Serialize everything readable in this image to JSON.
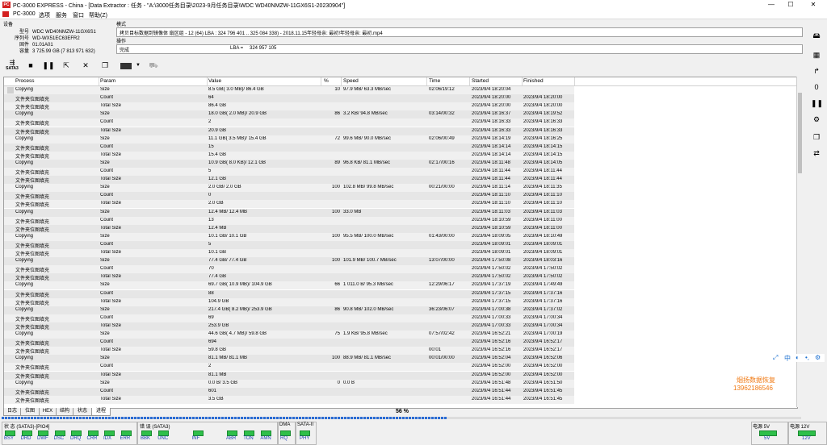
{
  "window": {
    "title": "PC-3000 EXPRESS - China - [Data Extractor : 任务 - \"A:\\3000任务目录\\2023-9月任务目录\\WDC WD40NMZW-11GX6S1-20230904\"]",
    "logo": "PC",
    "minimize": "—",
    "maximize": "☐",
    "close": "✕"
  },
  "menu": [
    "PC-3000",
    "选项",
    "服务",
    "窗口",
    "帮助(Z)"
  ],
  "device": {
    "section_label": "设备",
    "fields": [
      {
        "key": "型号",
        "value": "WDC WD40NMZW-11GX6S1"
      },
      {
        "key": "序列号",
        "value": "WD-WX51EC63EFR2"
      },
      {
        "key": "固件",
        "value": "01.01A01"
      },
      {
        "key": "容量",
        "value": "3 725.99 GB (7 813 971 632)"
      }
    ]
  },
  "mode": {
    "section_label": "模式",
    "value": "拷贝目标数据到镜像体  扇区组 - 12 (64) LBA : 324 796 401 .. 325 084 338) - 2018.11.15年轻母亲: 最初!年轻母亲: 最初.mp4",
    "op_label": "操作",
    "op_value": "完成",
    "lba_label": "LBA =",
    "lba_value": "324 957 105"
  },
  "toolbar": {
    "sata_label": "SATA3",
    "buttons": [
      "stop-icon",
      "pause-icon",
      "export-icon",
      "tools-icon",
      "copy-icon",
      "image-icon",
      "dropdown-icon",
      "disabled-icon"
    ]
  },
  "grid": {
    "columns": [
      "Process",
      "Param",
      "Value",
      "%",
      "Speed",
      "Time",
      "Started",
      "Finished"
    ],
    "rows": [
      [
        "Copying",
        "Size",
        "8.5 GB( 3.0 MB)/ 86.4 GB",
        "10",
        "97.9 MB/ 63.3 MB/sec",
        "02:06/19:12",
        "2023/9/4 18:20:04",
        ""
      ],
      [
        "文件夹位图填充",
        "Count",
        "64",
        "",
        "",
        "",
        "2023/9/4 18:20:00",
        "2023/9/4 18:20:00"
      ],
      [
        "文件夹位图填充",
        "Total Size",
        "86.4 GB",
        "",
        "",
        "",
        "2023/9/4 18:20:00",
        "2023/9/4 18:20:00"
      ],
      [
        "Copying",
        "Size",
        "18.0 GB( 2.0 MB)/ 20.9 GB",
        "86",
        "3.2 KB/ 94.8 MB/sec",
        "03:14/00:32",
        "2023/9/4 18:16:37",
        "2023/9/4 18:19:52"
      ],
      [
        "文件夹位图填充",
        "Count",
        "2",
        "",
        "",
        "",
        "2023/9/4 18:16:33",
        "2023/9/4 18:16:33"
      ],
      [
        "文件夹位图填充",
        "Total Size",
        "20.9 GB",
        "",
        "",
        "",
        "2023/9/4 18:16:33",
        "2023/9/4 18:16:33"
      ],
      [
        "Copying",
        "Size",
        "11.1 GB( 3.5 MB)/ 15.4 GB",
        "72",
        "99.6 MB/ 90.0 MB/sec",
        "02:06/00:49",
        "2023/9/4 18:14:19",
        "2023/9/4 18:16:25"
      ],
      [
        "文件夹位图填充",
        "Count",
        "15",
        "",
        "",
        "",
        "2023/9/4 18:14:14",
        "2023/9/4 18:14:15"
      ],
      [
        "文件夹位图填充",
        "Total Size",
        "15.4 GB",
        "",
        "",
        "",
        "2023/9/4 18:14:14",
        "2023/9/4 18:14:15"
      ],
      [
        "Copying",
        "Size",
        "10.9 GB( 8.0 KB)/ 12.1 GB",
        "89",
        "96.8 KB/ 81.1 MB/sec",
        "02:17/00:16",
        "2023/9/4 18:11:48",
        "2023/9/4 18:14:05"
      ],
      [
        "文件夹位图填充",
        "Count",
        "5",
        "",
        "",
        "",
        "2023/9/4 18:11:44",
        "2023/9/4 18:11:44"
      ],
      [
        "文件夹位图填充",
        "Total Size",
        "12.1 GB",
        "",
        "",
        "",
        "2023/9/4 18:11:44",
        "2023/9/4 18:11:44"
      ],
      [
        "Copying",
        "Size",
        "2.0 GB/ 2.0 GB",
        "100",
        "102.8 MB/ 99.8 MB/sec",
        "00:21/00:00",
        "2023/9/4 18:11:14",
        "2023/9/4 18:11:35"
      ],
      [
        "文件夹位图填充",
        "Count",
        "0",
        "",
        "",
        "",
        "2023/9/4 18:11:10",
        "2023/9/4 18:11:10"
      ],
      [
        "文件夹位图填充",
        "Total Size",
        "2.0 GB",
        "",
        "",
        "",
        "2023/9/4 18:11:10",
        "2023/9/4 18:11:10"
      ],
      [
        "Copying",
        "Size",
        "12.4 MB/ 12.4 MB",
        "100",
        "33.0 MB",
        "",
        "2023/9/4 18:11:03",
        "2023/9/4 18:11:03"
      ],
      [
        "文件夹位图填充",
        "Count",
        "13",
        "",
        "",
        "",
        "2023/9/4 18:10:59",
        "2023/9/4 18:11:00"
      ],
      [
        "文件夹位图填充",
        "Total Size",
        "12.4 MB",
        "",
        "",
        "",
        "2023/9/4 18:10:59",
        "2023/9/4 18:11:00"
      ],
      [
        "Copying",
        "Size",
        "10.1 GB/ 10.1 GB",
        "100",
        "95.5 MB/ 100.0 MB/sec",
        "01:43/00:00",
        "2023/9/4 18:09:05",
        "2023/9/4 18:10:49"
      ],
      [
        "文件夹位图填充",
        "Count",
        "5",
        "",
        "",
        "",
        "2023/9/4 18:09:01",
        "2023/9/4 18:09:01"
      ],
      [
        "文件夹位图填充",
        "Total Size",
        "10.1 GB",
        "",
        "",
        "",
        "2023/9/4 18:09:01",
        "2023/9/4 18:09:01"
      ],
      [
        "Copying",
        "Size",
        "77.4 GB/ 77.4 GB",
        "100",
        "101.9 MB/ 100.7 MB/sec",
        "13:07/00:00",
        "2023/9/4 17:50:08",
        "2023/9/4 18:03:16"
      ],
      [
        "文件夹位图填充",
        "Count",
        "70",
        "",
        "",
        "",
        "2023/9/4 17:50:02",
        "2023/9/4 17:50:02"
      ],
      [
        "文件夹位图填充",
        "Total Size",
        "77.4 GB",
        "",
        "",
        "",
        "2023/9/4 17:50:02",
        "2023/9/4 17:50:02"
      ],
      [
        "Copying",
        "Size",
        "69.7 GB( 10.9 MB)/ 104.9 GB",
        "66",
        "1 011.0 B/ 95.3 MB/sec",
        "12:29/06:17",
        "2023/9/4 17:37:19",
        "2023/9/4 17:49:49"
      ],
      [
        "文件夹位图填充",
        "Count",
        "88",
        "",
        "",
        "",
        "2023/9/4 17:37:15",
        "2023/9/4 17:37:16"
      ],
      [
        "文件夹位图填充",
        "Total Size",
        "104.9 GB",
        "",
        "",
        "",
        "2023/9/4 17:37:15",
        "2023/9/4 17:37:16"
      ],
      [
        "Copying",
        "Size",
        "217.4 GB( 8.2 MB)/ 253.9 GB",
        "86",
        "90.8 MB/ 102.0 MB/sec",
        "36:23/06:07",
        "2023/9/4 17:00:38",
        "2023/9/4 17:37:02"
      ],
      [
        "文件夹位图填充",
        "Count",
        "69",
        "",
        "",
        "",
        "2023/9/4 17:00:33",
        "2023/9/4 17:00:34"
      ],
      [
        "文件夹位图填充",
        "Total Size",
        "253.9 GB",
        "",
        "",
        "",
        "2023/9/4 17:00:33",
        "2023/9/4 17:00:34"
      ],
      [
        "Copying",
        "Size",
        "44.6 GB( 4.7 MB)/ 59.8 GB",
        "75",
        "1.9 KB/ 95.8 MB/sec",
        "07:57/02:42",
        "2023/9/4 16:52:21",
        "2023/9/4 17:00:19"
      ],
      [
        "文件夹位图填充",
        "Count",
        "694",
        "",
        "",
        "",
        "2023/9/4 16:52:16",
        "2023/9/4 16:52:17"
      ],
      [
        "文件夹位图填充",
        "Total Size",
        "59.8 GB",
        "",
        "",
        "00:01",
        "2023/9/4 16:52:16",
        "2023/9/4 16:52:17"
      ],
      [
        "Copying",
        "Size",
        "81.1 MB/ 81.1 MB",
        "100",
        "88.9 MB/ 81.1 MB/sec",
        "00:01/00:00",
        "2023/9/4 16:52:04",
        "2023/9/4 16:52:06"
      ],
      [
        "文件夹位图填充",
        "Count",
        "2",
        "",
        "",
        "",
        "2023/9/4 16:52:00",
        "2023/9/4 16:52:00"
      ],
      [
        "文件夹位图填充",
        "Total Size",
        "81.1 MB",
        "",
        "",
        "",
        "2023/9/4 16:52:00",
        "2023/9/4 16:52:00"
      ],
      [
        "Copying",
        "Size",
        "0.0 B/ 3.5 GB",
        "0",
        "0.0 B",
        "",
        "2023/9/4 16:51:48",
        "2023/9/4 16:51:50"
      ],
      [
        "文件夹位图填充",
        "Count",
        "601",
        "",
        "",
        "",
        "2023/9/4 16:51:44",
        "2023/9/4 16:51:45"
      ],
      [
        "文件夹位图填充",
        "Total Size",
        "3.5 GB",
        "",
        "",
        "",
        "2023/9/4 16:51:44",
        "2023/9/4 16:51:45"
      ]
    ]
  },
  "tabs": [
    "日志",
    "位图",
    "HEX",
    "结构",
    "状态",
    "进程"
  ],
  "active_tab": "进程",
  "progress": {
    "label": "56 %",
    "fraction": 0.56
  },
  "status": {
    "sata_title": "状 态 (SATA3)-[PIO4]",
    "sata_leds": [
      "BSY",
      "DRD",
      "DWF",
      "DSC",
      "DRQ",
      "CRR",
      "IDX",
      "ERR"
    ],
    "error_title": "错 误 (SATA3)",
    "error_leds": [
      "BBK",
      "UNC",
      "",
      "INF",
      "",
      "ABR",
      "TON",
      "AMN"
    ],
    "dma_title": "DMA",
    "dma_leds": [
      "RQ"
    ],
    "sataii_title": "SATA-II",
    "sataii_leds": [
      "PHY"
    ],
    "power5_title": "电源 5V",
    "power5_label": "5V",
    "power12_title": "电源 12V",
    "power12_label": "12V"
  },
  "watermark": {
    "line1": "烟扬数据恢复",
    "line2": "13962186546"
  },
  "ime": [
    "中",
    "◐",
    "•,",
    "⚙"
  ],
  "colors": {
    "led_on": "#2fbf4a",
    "led_label": "#1a3fb0",
    "progress": "#2a6cd4",
    "watermark": "#f07a14"
  }
}
